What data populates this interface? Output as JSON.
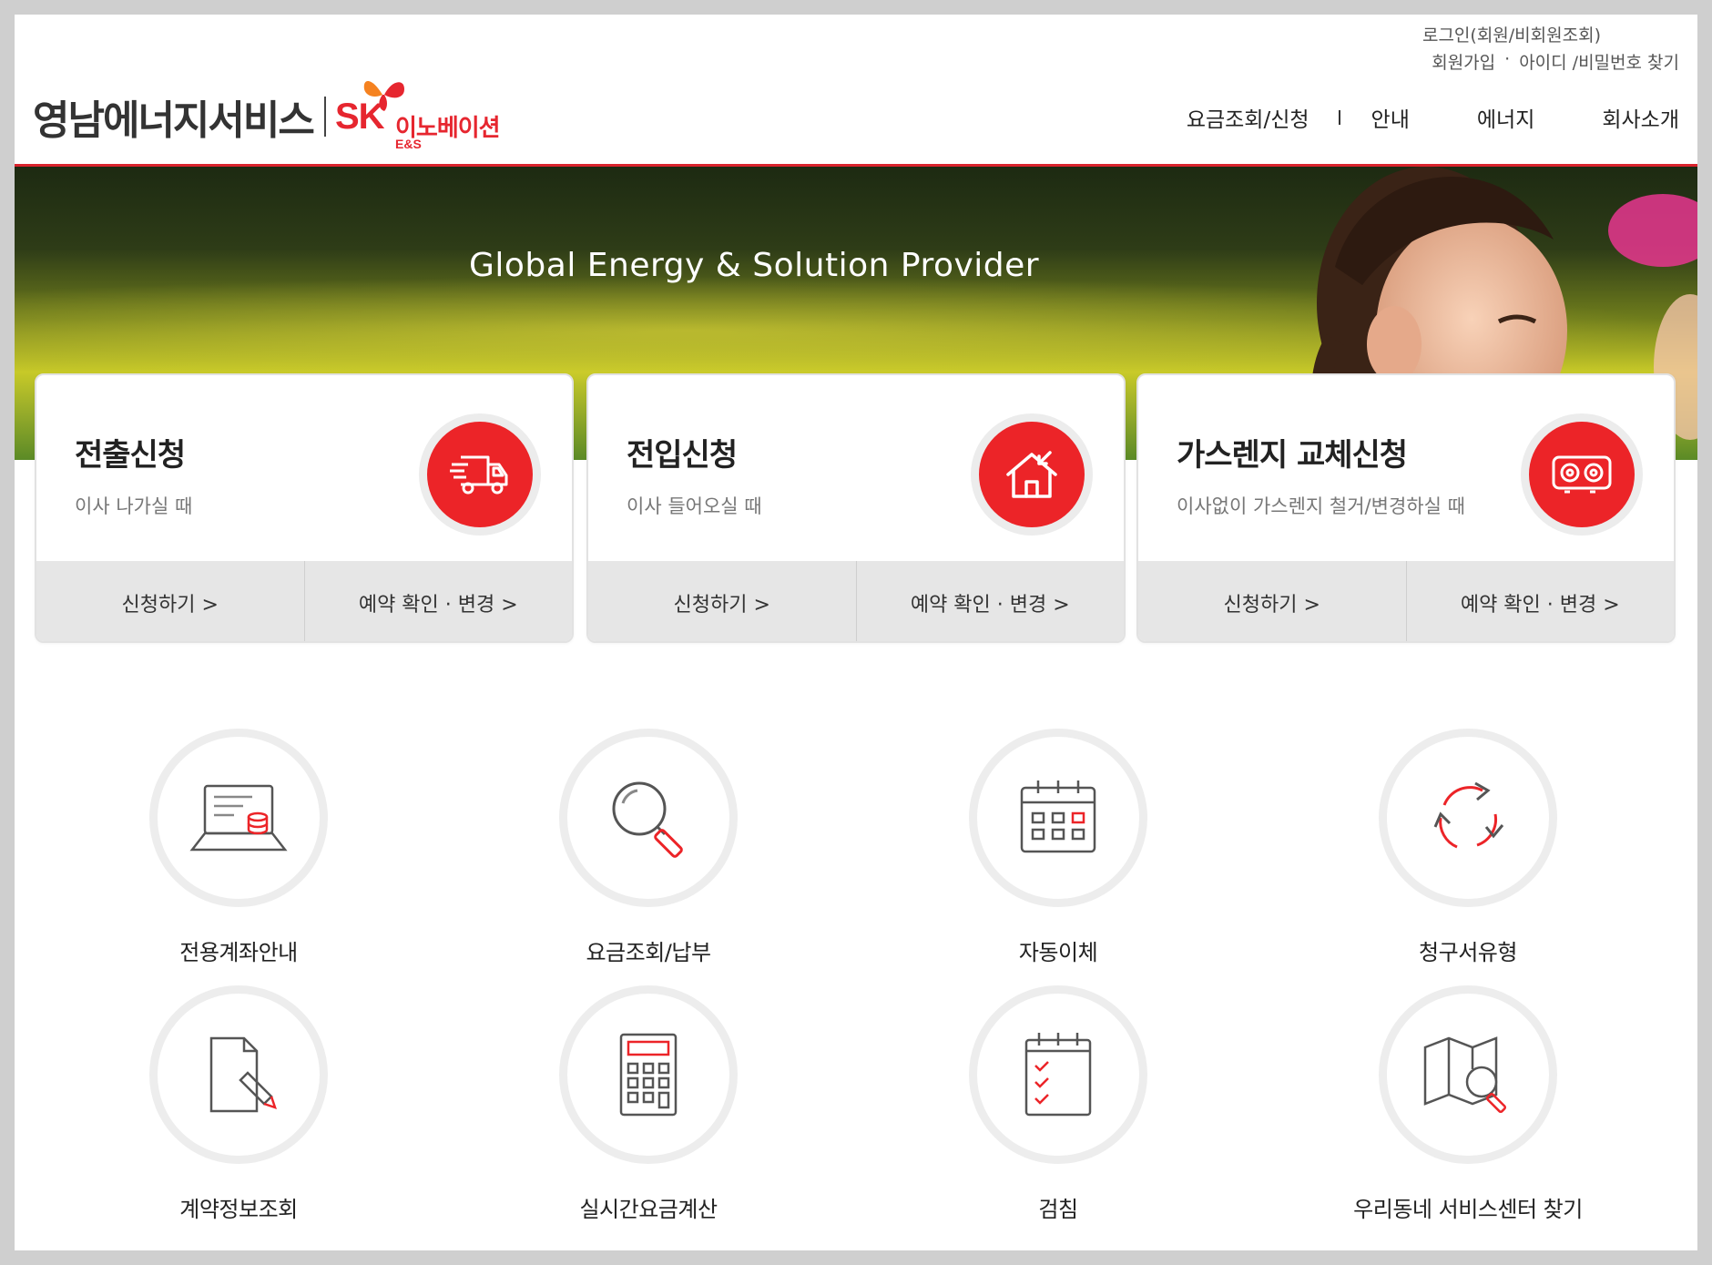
{
  "header": {
    "logo_text": "영남에너지서비스",
    "logo_sk": "SK",
    "logo_innovation": "이노베이션",
    "logo_es": "E&S",
    "util_login": "로그인(회원/비회원조회)",
    "util_signup": "회원가입",
    "util_dot": "·",
    "util_find": "아이디 /비밀번호 찾기"
  },
  "nav": {
    "items": [
      "요금조회/신청",
      "안내",
      "에너지",
      "회사소개"
    ]
  },
  "hero": {
    "title": "Global Energy & Solution Provider"
  },
  "cards": [
    {
      "title": "전출신청",
      "subtitle": "이사 나가실 때",
      "icon": "truck-icon",
      "apply": "신청하기 >",
      "reserve": "예약 확인 · 변경 >"
    },
    {
      "title": "전입신청",
      "subtitle": "이사 들어오실 때",
      "icon": "house-icon",
      "apply": "신청하기 >",
      "reserve": "예약 확인 · 변경 >"
    },
    {
      "title": "가스렌지 교체신청",
      "subtitle": "이사없이 가스렌지 철거/변경하실 때",
      "icon": "gas-range-icon",
      "apply": "신청하기 >",
      "reserve": "예약 확인 · 변경 >"
    }
  ],
  "services": [
    {
      "label": "전용계좌안내",
      "icon": "laptop-database-icon"
    },
    {
      "label": "요금조회/납부",
      "icon": "magnifier-icon"
    },
    {
      "label": "자동이체",
      "icon": "calendar-icon"
    },
    {
      "label": "청구서유형",
      "icon": "refresh-cycle-icon"
    },
    {
      "label": "계약정보조회",
      "icon": "document-pen-icon"
    },
    {
      "label": "실시간요금계산",
      "icon": "calculator-icon"
    },
    {
      "label": "검침",
      "icon": "checklist-icon"
    },
    {
      "label": "우리동네 서비스센터 찾기",
      "icon": "map-search-icon"
    }
  ],
  "colors": {
    "brand_red": "#e6262f",
    "icon_red": "#ec2428",
    "card_footer": "#e6e6e6"
  }
}
